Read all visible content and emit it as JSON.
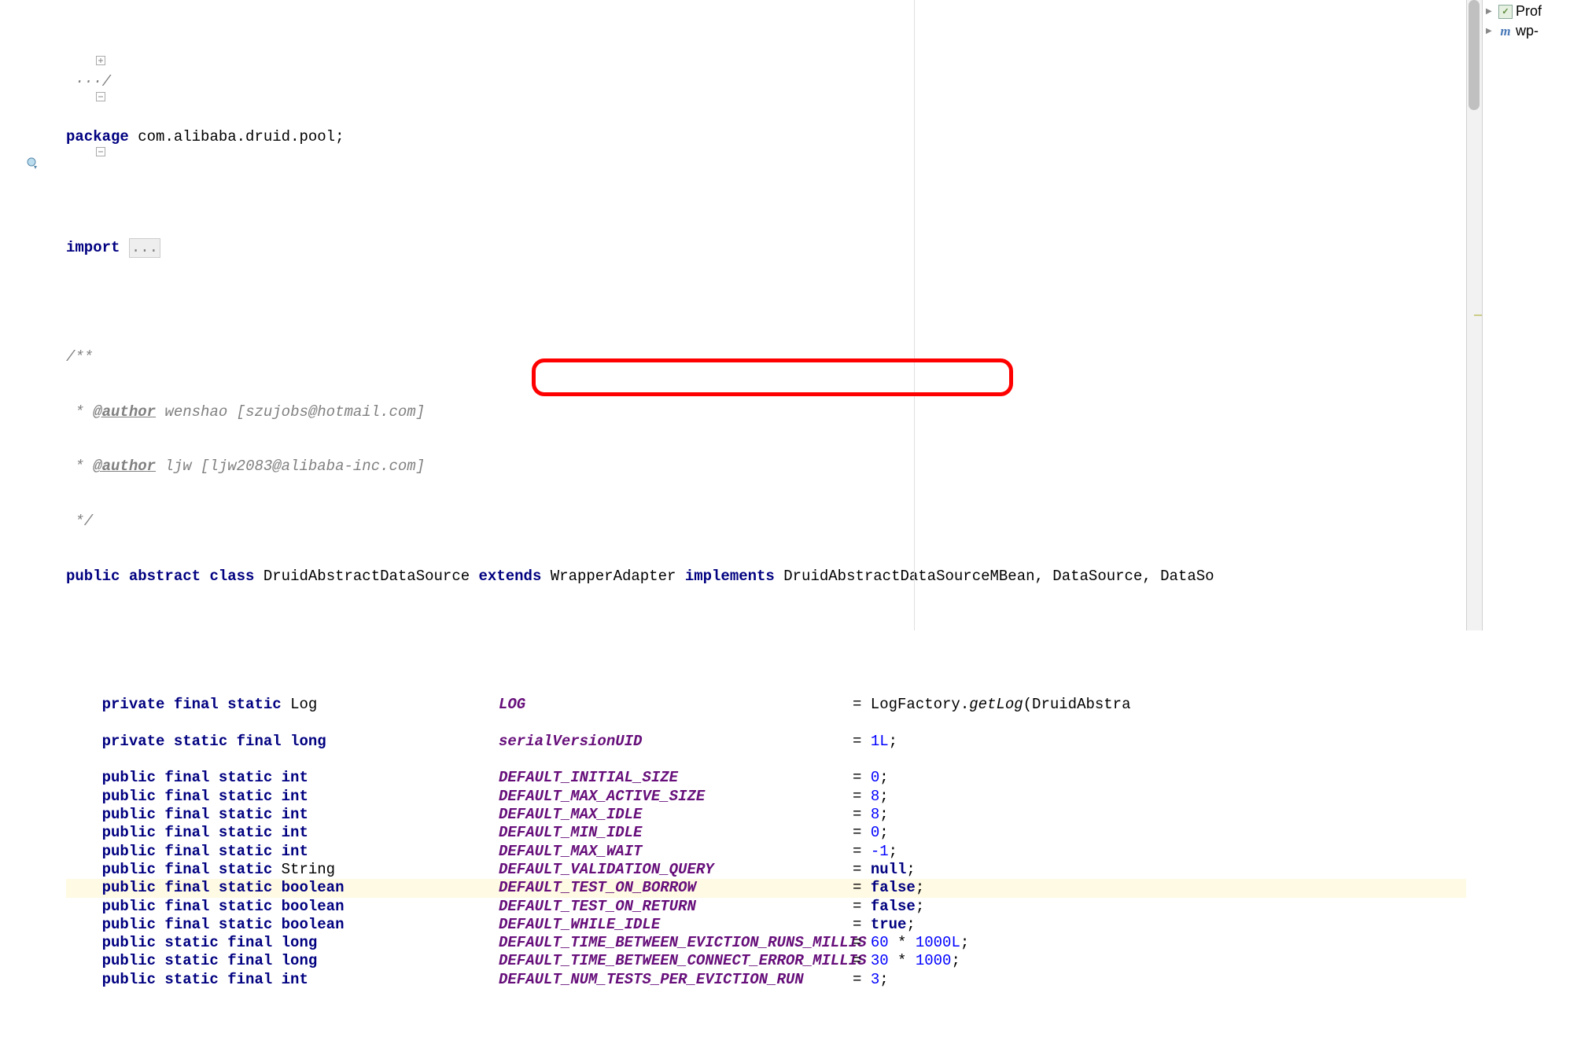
{
  "package_kw": "package",
  "package_name": "com.alibaba.druid.pool",
  "import_kw": "import",
  "import_ellipsis": "...",
  "javadoc": {
    "open": "/**",
    "author_tag": "@author",
    "author1": " wenshao [szujobs@hotmail.com]",
    "author2": " ljw [ljw2083@alibaba-inc.com]",
    "close": " */",
    "star": " * "
  },
  "class_decl": {
    "public": "public",
    "abstract": "abstract",
    "class": "class",
    "name": "DruidAbstractDataSource",
    "extends": "extends",
    "super": "WrapperAdapter",
    "implements": "implements",
    "ifaces": "DruidAbstractDataSourceMBean, DataSource, DataSo"
  },
  "fields": [
    {
      "mods": "private final static",
      "type": "Log",
      "name": "LOG",
      "value": "= LogFactory.",
      "method": "getLog",
      "tail": "(DruidAbstra"
    },
    {
      "blank": true
    },
    {
      "mods": "private static final",
      "type": "long",
      "name": "serialVersionUID",
      "value": "= ",
      "num": "1L",
      "tail": ";"
    },
    {
      "blank": true
    },
    {
      "mods": "public final static",
      "type": "int",
      "name": "DEFAULT_INITIAL_SIZE",
      "value": "= ",
      "num": "0",
      "tail": ";"
    },
    {
      "mods": "public final static",
      "type": "int",
      "name": "DEFAULT_MAX_ACTIVE_SIZE",
      "value": "= ",
      "num": "8",
      "tail": ";"
    },
    {
      "mods": "public final static",
      "type": "int",
      "name": "DEFAULT_MAX_IDLE",
      "value": "= ",
      "num": "8",
      "tail": ";"
    },
    {
      "mods": "public final static",
      "type": "int",
      "name": "DEFAULT_MIN_IDLE",
      "value": "= ",
      "num": "0",
      "tail": ";"
    },
    {
      "mods": "public final static",
      "type": "int",
      "name": "DEFAULT_MAX_WAIT",
      "value": "= ",
      "num": "-1",
      "tail": ";"
    },
    {
      "mods": "public final static",
      "type": "String",
      "name": "DEFAULT_VALIDATION_QUERY",
      "value": "= ",
      "kw": "null",
      "tail": ";"
    },
    {
      "mods": "public final static",
      "type": "boolean",
      "name": "DEFAULT_TEST_ON_BORROW",
      "value": "= ",
      "kw": "false",
      "tail": ";",
      "highlight": true
    },
    {
      "mods": "public final static",
      "type": "boolean",
      "name": "DEFAULT_TEST_ON_RETURN",
      "value": "= ",
      "kw": "false",
      "tail": ";"
    },
    {
      "mods": "public final static",
      "type": "boolean",
      "name": "DEFAULT_WHILE_IDLE",
      "value": "= ",
      "kw": "true",
      "tail": ";"
    },
    {
      "mods": "public static final",
      "type": "long",
      "name": "DEFAULT_TIME_BETWEEN_EVICTION_RUNS_MILLIS",
      "value": "= ",
      "num": "60",
      "op": " * ",
      "num2": "1000L",
      "tail": ";"
    },
    {
      "mods": "public static final",
      "type": "long",
      "name": "DEFAULT_TIME_BETWEEN_CONNECT_ERROR_MILLIS",
      "value": "= ",
      "num": "30",
      "op": " * ",
      "num2": "1000",
      "tail": ";"
    },
    {
      "mods": "public static final",
      "type": "int",
      "name": "DEFAULT_NUM_TESTS_PER_EVICTION_RUN",
      "value": "= ",
      "num": "3",
      "tail": ";"
    }
  ],
  "sidebar": {
    "items": [
      {
        "icon": "green",
        "label": "Prof"
      },
      {
        "icon": "m",
        "label": "wp-"
      }
    ]
  },
  "icons": {
    "override": "o",
    "fold_open": "⊖",
    "fold_closed": "⊕",
    "arrow": "▶"
  },
  "colors": {
    "highlight": "#fffae3",
    "redbox": "#ff0000"
  }
}
